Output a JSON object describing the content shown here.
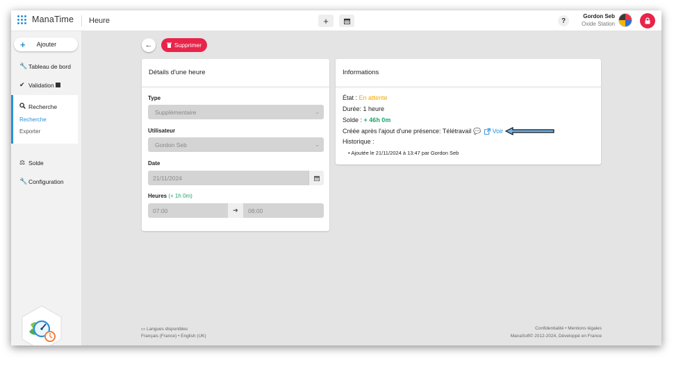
{
  "app": {
    "name": "ManaTime",
    "page_title": "Heure"
  },
  "toolbar": {
    "add_icon": "+",
    "calendar_icon": "calendar"
  },
  "user": {
    "name": "Gordon Seb",
    "organization": "Oxide Station"
  },
  "help_label": "?",
  "sidebar": {
    "add_label": "Ajouter",
    "items": [
      {
        "label": "Tableau de bord",
        "icon": "wrench-icon"
      },
      {
        "label": "Validation",
        "icon": "check-icon"
      },
      {
        "label": "Recherche",
        "icon": "search-icon"
      },
      {
        "label": "Solde",
        "icon": "scale-icon"
      },
      {
        "label": "Configuration",
        "icon": "wrench-icon"
      }
    ],
    "sub_items": [
      {
        "label": "Recherche",
        "active": true
      },
      {
        "label": "Exporter",
        "active": false
      }
    ]
  },
  "actions": {
    "delete_label": "Supprimer"
  },
  "details": {
    "title": "Détails d'une heure",
    "type_label": "Type",
    "type_value": "Supplémentaire",
    "user_label": "Utilisateur",
    "user_value": "Gordon Seb",
    "date_label": "Date",
    "date_value": "21/11/2024",
    "hours_label": "Heures",
    "hours_extra": "(+ 1h 0m)",
    "start_time": "07:00",
    "end_time": "08:00"
  },
  "info": {
    "title": "Informations",
    "state_label": "État :",
    "state_value": "En attente",
    "duration": "Durée: 1 heure",
    "balance_label": "Solde :",
    "balance_value": "+ 46h 0m",
    "created_text": "Créée après l'ajout d'une présence: Télétravail",
    "view_label": "Voir",
    "history_label": "Historique :",
    "history_items": [
      "Ajoutée le 21/11/2024 à 13:47 par Gordon Seb"
    ]
  },
  "footer": {
    "languages_title": "Langues disponibles",
    "languages": "Français (France) • English (UK)",
    "legal": "Confidentialité • Mentions légales",
    "copyright": "ManaSoft© 2012-2024, Développé en France"
  },
  "colors": {
    "accent": "#2a8fd6",
    "danger": "#e8244a",
    "success": "#1aa56b",
    "warning": "#f2a900"
  }
}
